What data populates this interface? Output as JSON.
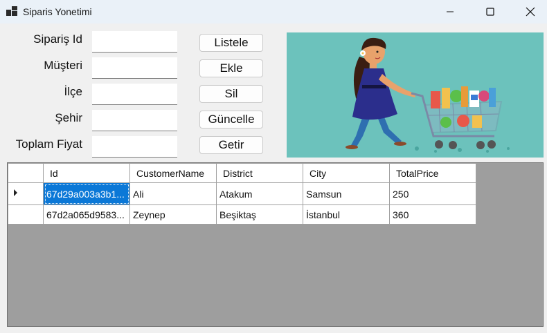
{
  "window": {
    "title": "Siparis Yonetimi"
  },
  "form": {
    "fields": [
      {
        "label": "Sipariş Id",
        "value": ""
      },
      {
        "label": "Müşteri",
        "value": ""
      },
      {
        "label": "İlçe",
        "value": ""
      },
      {
        "label": "Şehir",
        "value": ""
      },
      {
        "label": "Toplam Fiyat",
        "value": ""
      }
    ]
  },
  "buttons": {
    "list": "Listele",
    "add": "Ekle",
    "delete": "Sil",
    "update": "Güncelle",
    "get": "Getir"
  },
  "grid": {
    "columns": [
      "Id",
      "CustomerName",
      "District",
      "City",
      "TotalPrice"
    ],
    "rows": [
      [
        "67d29a003a3b1...",
        "Ali",
        "Atakum",
        "Samsun",
        "250"
      ],
      [
        "67d2a065d9583...",
        "Zeynep",
        "Beşiktaş",
        "İstanbul",
        "360"
      ]
    ],
    "selected_row": 0,
    "selected_column": 0
  },
  "colors": {
    "titlebar": "#eaf1f8",
    "selection": "#0b78d7",
    "grid_background": "#9e9e9e",
    "image_background": "#6cc2bc"
  },
  "icons": [
    "app-icon",
    "minimize-icon",
    "maximize-icon",
    "close-icon",
    "current-row-arrow-icon"
  ]
}
